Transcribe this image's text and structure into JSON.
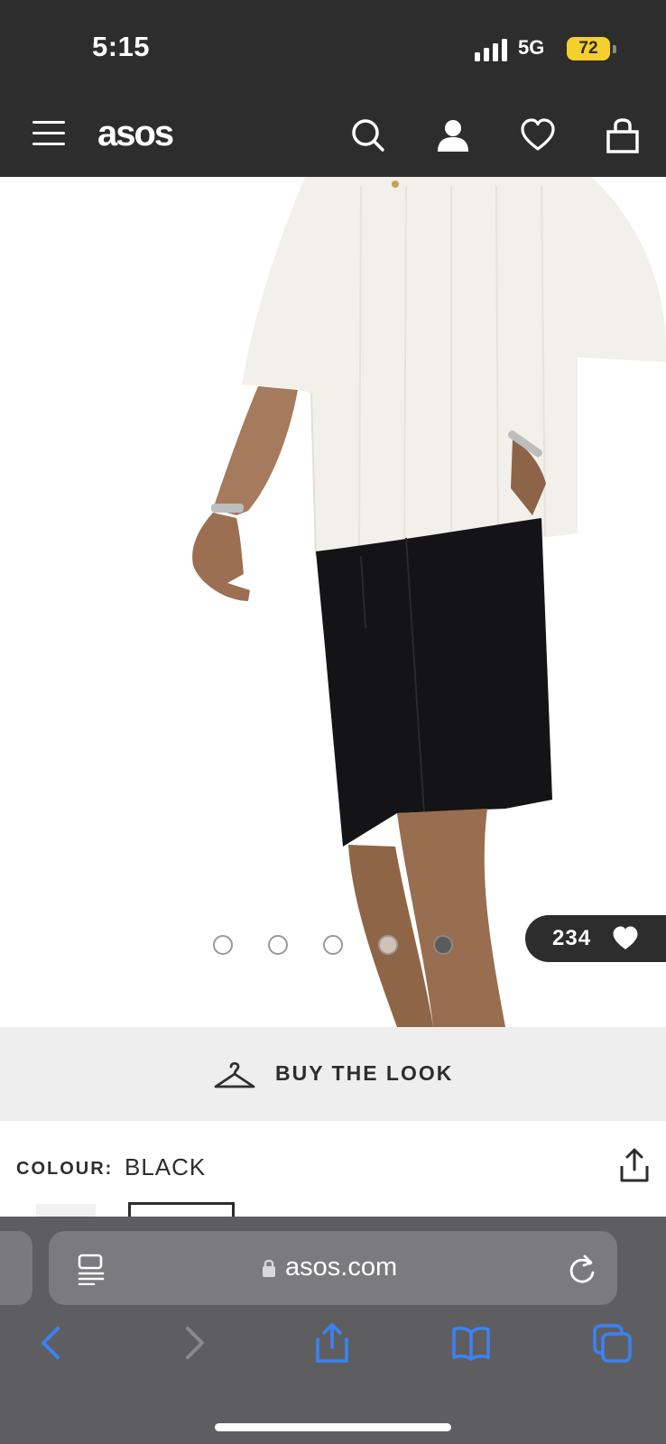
{
  "status_bar": {
    "time": "5:15",
    "network": "5G",
    "battery": "72"
  },
  "header": {
    "logo": "asos",
    "icons": [
      "menu-icon",
      "search-icon",
      "account-icon",
      "heart-icon",
      "bag-icon"
    ]
  },
  "gallery": {
    "image_count": 5,
    "active_index": 4,
    "likes": "234"
  },
  "buy_the_look": {
    "label": "BUY THE LOOK"
  },
  "product": {
    "colour_label": "COLOUR:",
    "colour_value": "BLACK"
  },
  "browser": {
    "url": "asos.com",
    "toolbar": [
      "back-icon",
      "forward-icon",
      "share-icon",
      "bookmarks-icon",
      "tabs-icon"
    ]
  },
  "colors": {
    "header_bg": "#2d2d2d",
    "battery": "#f5cf2b",
    "safari_blue": "#3a82f7",
    "safari_bg": "#5e5e60"
  }
}
